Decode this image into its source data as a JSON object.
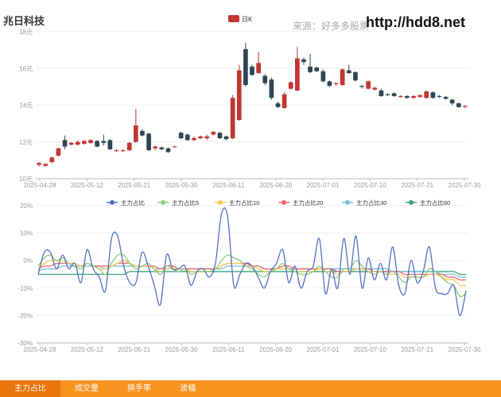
{
  "header": {
    "stock_name": "兆日科技",
    "source": "来源：好多多股票",
    "url": "http://hdd8.net"
  },
  "tabs": [
    {
      "label": "主力占比",
      "active": true
    },
    {
      "label": "成交量",
      "active": false
    },
    {
      "label": "换手率",
      "active": false
    },
    {
      "label": "波幅",
      "active": false
    }
  ],
  "colors": {
    "up": "#c23531",
    "down": "#2f4554",
    "grid": "#eceff4",
    "axis": "#999999",
    "tab_bg": "#f7931e"
  },
  "chart_data": [
    {
      "type": "candlestick",
      "legend": [
        "日K"
      ],
      "legend_position": "top-center",
      "y_ticks": [
        "10元",
        "12元",
        "14元",
        "16元",
        "18元"
      ],
      "ylim": [
        10,
        18
      ],
      "x_ticks": [
        "2025-04-28",
        "2025-05-12",
        "2025-05-21",
        "2025-05-30",
        "2025-06-11",
        "2025-06-20",
        "2025-07-01",
        "2025-07-10",
        "2025-07-21",
        "2025-07-30"
      ],
      "series": [
        {
          "name": "日K",
          "ohlc": [
            [
              10.75,
              10.85,
              10.65,
              10.9
            ],
            [
              10.7,
              10.8,
              10.65,
              10.85
            ],
            [
              10.9,
              11.15,
              10.85,
              11.2
            ],
            [
              11.25,
              11.65,
              11.2,
              11.7
            ],
            [
              12.1,
              11.75,
              11.6,
              12.35
            ],
            [
              11.85,
              11.95,
              11.8,
              12.0
            ],
            [
              11.85,
              12.0,
              11.8,
              12.1
            ],
            [
              11.9,
              12.05,
              11.85,
              12.1
            ],
            [
              11.95,
              12.1,
              11.9,
              12.15
            ],
            [
              12.05,
              11.75,
              11.7,
              12.1
            ],
            [
              12.05,
              11.95,
              11.8,
              12.4
            ],
            [
              12.1,
              11.6,
              11.55,
              12.15
            ],
            [
              11.5,
              11.55,
              11.45,
              11.6
            ],
            [
              11.5,
              11.55,
              11.45,
              11.6
            ],
            [
              11.55,
              11.95,
              11.5,
              12.0
            ],
            [
              12.0,
              12.9,
              11.95,
              13.8
            ],
            [
              12.6,
              12.35,
              12.3,
              12.7
            ],
            [
              12.45,
              11.55,
              11.5,
              12.5
            ],
            [
              11.65,
              11.75,
              11.55,
              11.8
            ],
            [
              11.7,
              11.6,
              11.55,
              11.75
            ],
            [
              11.65,
              11.45,
              11.4,
              11.7
            ],
            [
              11.75,
              11.75,
              11.7,
              11.8
            ],
            [
              12.5,
              12.2,
              12.15,
              12.55
            ],
            [
              12.4,
              12.1,
              12.05,
              12.45
            ],
            [
              12.1,
              12.2,
              12.05,
              12.3
            ],
            [
              12.2,
              12.3,
              12.15,
              12.35
            ],
            [
              12.2,
              12.3,
              12.1,
              12.4
            ],
            [
              12.4,
              12.55,
              12.35,
              12.6
            ],
            [
              12.5,
              12.2,
              12.15,
              12.55
            ],
            [
              12.3,
              12.15,
              12.1,
              12.35
            ],
            [
              12.2,
              14.4,
              12.15,
              14.55
            ],
            [
              13.2,
              15.9,
              13.15,
              16.2
            ],
            [
              17.05,
              15.1,
              15.0,
              17.4
            ],
            [
              16.1,
              15.65,
              15.6,
              16.2
            ],
            [
              15.75,
              16.3,
              15.7,
              16.9
            ],
            [
              15.6,
              15.2,
              15.1,
              15.7
            ],
            [
              15.4,
              14.4,
              14.3,
              15.5
            ],
            [
              14.1,
              13.9,
              13.85,
              14.2
            ],
            [
              13.85,
              14.6,
              13.8,
              14.7
            ],
            [
              14.9,
              15.25,
              14.85,
              15.3
            ],
            [
              14.8,
              16.55,
              14.75,
              17.2
            ],
            [
              16.5,
              16.35,
              16.2,
              16.6
            ],
            [
              16.1,
              15.8,
              15.75,
              16.8
            ],
            [
              16.05,
              15.85,
              15.8,
              16.1
            ],
            [
              15.85,
              15.3,
              15.25,
              15.95
            ],
            [
              15.3,
              15.05,
              15.0,
              15.35
            ],
            [
              15.15,
              15.2,
              15.05,
              15.25
            ],
            [
              15.1,
              15.95,
              15.05,
              16.0
            ],
            [
              15.9,
              15.75,
              15.7,
              16.2
            ],
            [
              15.8,
              15.35,
              15.3,
              15.85
            ],
            [
              15.05,
              15.0,
              14.9,
              15.1
            ],
            [
              14.9,
              15.3,
              14.85,
              15.35
            ],
            [
              14.85,
              14.95,
              14.8,
              15.0
            ],
            [
              14.8,
              14.5,
              14.45,
              14.9
            ],
            [
              14.6,
              14.55,
              14.5,
              14.65
            ],
            [
              14.65,
              14.5,
              14.45,
              14.7
            ],
            [
              14.45,
              14.5,
              14.4,
              14.55
            ],
            [
              14.5,
              14.4,
              14.35,
              14.55
            ],
            [
              14.4,
              14.5,
              14.35,
              14.55
            ],
            [
              14.45,
              14.55,
              14.4,
              14.6
            ],
            [
              14.4,
              14.75,
              14.35,
              14.8
            ],
            [
              14.7,
              14.4,
              14.35,
              14.75
            ],
            [
              14.5,
              14.45,
              14.4,
              14.55
            ],
            [
              14.45,
              14.35,
              14.3,
              14.5
            ],
            [
              14.3,
              14.1,
              14.0,
              14.35
            ],
            [
              14.1,
              13.9,
              13.85,
              14.15
            ],
            [
              13.9,
              13.95,
              13.85,
              14.0
            ]
          ]
        }
      ]
    },
    {
      "type": "line",
      "legend_position": "top-center",
      "y_ticks": [
        "-30%",
        "-20%",
        "-10%",
        "0%",
        "10%",
        "20%"
      ],
      "ylim": [
        -30,
        20
      ],
      "x_ticks": [
        "2025-04-28",
        "2025-05-12",
        "2025-05-21",
        "2025-05-30",
        "2025-06-11",
        "2025-06-20",
        "2025-07-01",
        "2025-07-10",
        "2025-07-21",
        "2025-07-30"
      ],
      "series": [
        {
          "name": "主力占比",
          "color": "#5470c6",
          "values": [
            -5,
            3,
            3,
            -3,
            2,
            -3,
            -1,
            -8,
            4,
            -3,
            -6,
            -11,
            8,
            9,
            -2,
            -8,
            -8,
            3,
            -2,
            -9,
            -16,
            2,
            -3,
            -3,
            -2,
            -9,
            -4,
            -3,
            -6,
            -1,
            17,
            16,
            -9,
            -5,
            -1,
            -2,
            -6,
            -10,
            -4,
            -1,
            4,
            -8,
            -2,
            -10,
            -4,
            -2,
            8,
            -12,
            -3,
            -10,
            8,
            -5,
            9,
            -10,
            1,
            -7,
            -1,
            -7,
            5,
            -9,
            -12,
            0,
            -8,
            -4,
            5,
            -10,
            -12,
            -12,
            -9,
            -20,
            -11
          ]
        },
        {
          "name": "主力占比5",
          "color": "#91cc75",
          "values": [
            -2,
            1,
            2,
            0,
            1,
            -1,
            -2,
            -3,
            -1,
            -2,
            -3,
            -5,
            -1,
            2,
            2,
            -1,
            -3,
            -2,
            -1,
            -3,
            -5,
            -2,
            -3,
            -4,
            -3,
            -5,
            -4,
            -4,
            -4,
            -3,
            0,
            2,
            1,
            0,
            -2,
            -3,
            -5,
            -6,
            -4,
            -3,
            -1,
            -3,
            -4,
            -5,
            -5,
            -4,
            -2,
            -4,
            -6,
            -6,
            -3,
            -3,
            0,
            -2,
            -4,
            -5,
            -4,
            -5,
            -4,
            -6,
            -8,
            -6,
            -6,
            -6,
            -3,
            -4,
            -6,
            -8,
            -9,
            -13,
            -12
          ]
        },
        {
          "name": "主力占比10",
          "color": "#fac858",
          "values": [
            -3,
            -1,
            0,
            0,
            0,
            -1,
            -1,
            -2,
            -1,
            -2,
            -3,
            -3,
            -2,
            -1,
            0,
            -1,
            -2,
            -2,
            -2,
            -3,
            -4,
            -3,
            -3,
            -3,
            -3,
            -4,
            -4,
            -4,
            -4,
            -3,
            -2,
            -1,
            -1,
            -1,
            -2,
            -2,
            -3,
            -4,
            -4,
            -3,
            -3,
            -3,
            -4,
            -4,
            -4,
            -4,
            -3,
            -4,
            -4,
            -5,
            -4,
            -4,
            -3,
            -3,
            -4,
            -4,
            -4,
            -5,
            -5,
            -5,
            -6,
            -6,
            -6,
            -6,
            -5,
            -5,
            -6,
            -7,
            -7,
            -9,
            -9
          ]
        },
        {
          "name": "主力占比20",
          "color": "#ee6666",
          "values": [
            -3,
            -2,
            -2,
            -1,
            -1,
            -1,
            -1,
            -2,
            -1,
            -2,
            -2,
            -2,
            -2,
            -1,
            -1,
            -1,
            -2,
            -2,
            -2,
            -2,
            -3,
            -2,
            -2,
            -3,
            -3,
            -3,
            -3,
            -3,
            -3,
            -3,
            -2,
            -1,
            -1,
            -1,
            -1,
            -2,
            -2,
            -3,
            -3,
            -3,
            -2,
            -2,
            -3,
            -3,
            -3,
            -3,
            -3,
            -3,
            -3,
            -4,
            -4,
            -4,
            -3,
            -3,
            -3,
            -4,
            -4,
            -4,
            -4,
            -4,
            -5,
            -5,
            -5,
            -5,
            -5,
            -5,
            -5,
            -6,
            -6,
            -7,
            -7
          ]
        },
        {
          "name": "主力占比30",
          "color": "#73c0de",
          "values": [
            -4,
            -3,
            -3,
            -3,
            -2,
            -2,
            -2,
            -2,
            -2,
            -2,
            -2,
            -3,
            -2,
            -2,
            -2,
            -2,
            -2,
            -2,
            -2,
            -3,
            -3,
            -3,
            -3,
            -3,
            -3,
            -3,
            -3,
            -3,
            -3,
            -3,
            -3,
            -2,
            -2,
            -2,
            -2,
            -2,
            -2,
            -3,
            -3,
            -3,
            -3,
            -3,
            -3,
            -3,
            -3,
            -3,
            -3,
            -3,
            -3,
            -3,
            -3,
            -3,
            -3,
            -3,
            -3,
            -3,
            -3,
            -3,
            -4,
            -4,
            -4,
            -4,
            -4,
            -4,
            -4,
            -4,
            -5,
            -5,
            -5,
            -6,
            -6
          ]
        },
        {
          "name": "主力占比60",
          "color": "#3ba272",
          "values": [
            -5,
            -5,
            -5,
            -5,
            -5,
            -5,
            -5,
            -5,
            -5,
            -5,
            -5,
            -5,
            -5,
            -5,
            -5,
            -4,
            -4,
            -4,
            -4,
            -4,
            -4,
            -4,
            -4,
            -4,
            -4,
            -4,
            -4,
            -4,
            -4,
            -4,
            -4,
            -4,
            -4,
            -4,
            -4,
            -4,
            -4,
            -4,
            -4,
            -4,
            -4,
            -4,
            -4,
            -4,
            -4,
            -4,
            -4,
            -4,
            -4,
            -4,
            -4,
            -4,
            -4,
            -4,
            -4,
            -4,
            -4,
            -4,
            -4,
            -4,
            -4,
            -4,
            -4,
            -4,
            -4,
            -4,
            -4,
            -4,
            -4,
            -5,
            -5
          ]
        }
      ]
    }
  ]
}
